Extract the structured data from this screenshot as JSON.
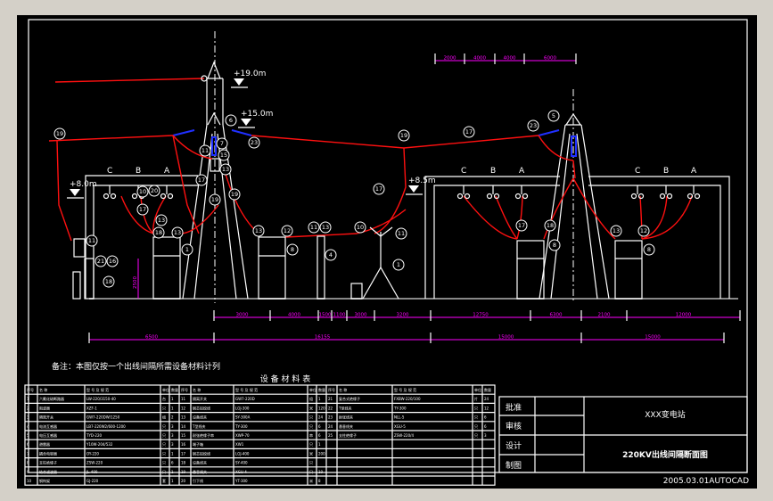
{
  "drawing": {
    "phase_labels": [
      "C",
      "B",
      "A"
    ],
    "elevations": [
      "+19.0m",
      "+15.0m",
      "+8.0m",
      "+8.5m"
    ],
    "height_dim": "2500",
    "top_dims": [
      "2000",
      "4000",
      "4000",
      "6000"
    ],
    "row1_dims": [
      "3000",
      "4000",
      "1500",
      "1100",
      "3000",
      "3200",
      "12750",
      "6300",
      "2100",
      "12000"
    ],
    "row2_dims": [
      "6500",
      "16155",
      "15000",
      "15000"
    ],
    "callouts": [
      "19",
      "6",
      "23",
      "7",
      "11",
      "15",
      "13",
      "17",
      "19",
      "19",
      "10",
      "20",
      "17",
      "13",
      "18",
      "13",
      "1",
      "11",
      "21",
      "16",
      "18",
      "13",
      "12",
      "8",
      "11",
      "13",
      "4",
      "10",
      "11",
      "1",
      "19",
      "17",
      "23",
      "5",
      "17",
      "17",
      "18",
      "8",
      "13",
      "12",
      "8"
    ]
  },
  "note": "备注：本图仅按一个出线间隔所需设备材料计列",
  "table": {
    "title": "设 备 材 料 表",
    "headers": [
      "序号",
      "名 称",
      "型 号 及 规 范",
      "单位",
      "数量"
    ],
    "rows": [
      [
        "1",
        "六氟化硫断路器",
        "LW-220/3150-40",
        "台",
        "1",
        "11",
        "隔离开关",
        "GW7-220D",
        "组",
        "1",
        "21",
        "复合式绝缘子",
        "FXBW-220/100",
        "片",
        "24"
      ],
      [
        "2",
        "阻波器",
        "XZF-1",
        "只",
        "1",
        "12",
        "钢芯铝绞线",
        "LGJ-300",
        "米",
        "120",
        "22",
        "T型线夹",
        "TY-300",
        "只",
        "12"
      ],
      [
        "3",
        "隔离开关",
        "GW7-220DW/1250",
        "组",
        "2",
        "13",
        "设备线夹",
        "SY-300A",
        "只",
        "24",
        "23",
        "耐张线夹",
        "NLL-5",
        "只",
        "6"
      ],
      [
        "4",
        "电流互感器",
        "LB7-220W2/600-1200",
        "只",
        "3",
        "14",
        "T型线夹",
        "TY-300",
        "只",
        "6",
        "24",
        "悬垂线夹",
        "XGU-5",
        "只",
        "6"
      ],
      [
        "5",
        "电压互感器",
        "TYD-220",
        "只",
        "3",
        "15",
        "耐张绝缘子串",
        "XWP-70",
        "串",
        "6",
        "25",
        "支柱绝缘子",
        "ZSW-220/4",
        "只",
        "3"
      ],
      [
        "6",
        "避雷器",
        "Y10W-204/532",
        "只",
        "3",
        "16",
        "端子箱",
        "XW1",
        "只",
        "1",
        "",
        "",
        "",
        "",
        ""
      ],
      [
        "7",
        "耦合电容器",
        "OY-220",
        "只",
        "1",
        "17",
        "钢芯铝绞线",
        "LGJ-400",
        "米",
        "200",
        "",
        "",
        "",
        "",
        ""
      ],
      [
        "8",
        "支柱绝缘子",
        "ZSW-220",
        "只",
        "6",
        "18",
        "设备线夹",
        "SY-400",
        "只",
        "",
        "",
        "",
        "",
        "",
        ""
      ],
      [
        "9",
        "结合滤波器",
        "JL-400",
        "只",
        "1",
        "19",
        "悬垂线夹",
        "XGU-4",
        "只",
        "10",
        "",
        "",
        "",
        "",
        ""
      ],
      [
        "10",
        "钢构架",
        "GJ-220",
        "套",
        "1",
        "20",
        "引下线",
        "YT-300",
        "米",
        "8",
        "",
        "",
        "",
        "",
        ""
      ]
    ]
  },
  "title_block": {
    "labels": [
      "批准",
      "审核",
      "设计",
      "制图"
    ],
    "station": "XXX变电站",
    "drawing_name": "220KV出线间隔断面图"
  },
  "status": "2005.03.01AUTOCAD",
  "colors": {
    "conductor": "#ff1010",
    "insulator": "#2030ff",
    "dimension": "#ff00ff",
    "background": "#000000",
    "frame": "#d4d0c8"
  }
}
